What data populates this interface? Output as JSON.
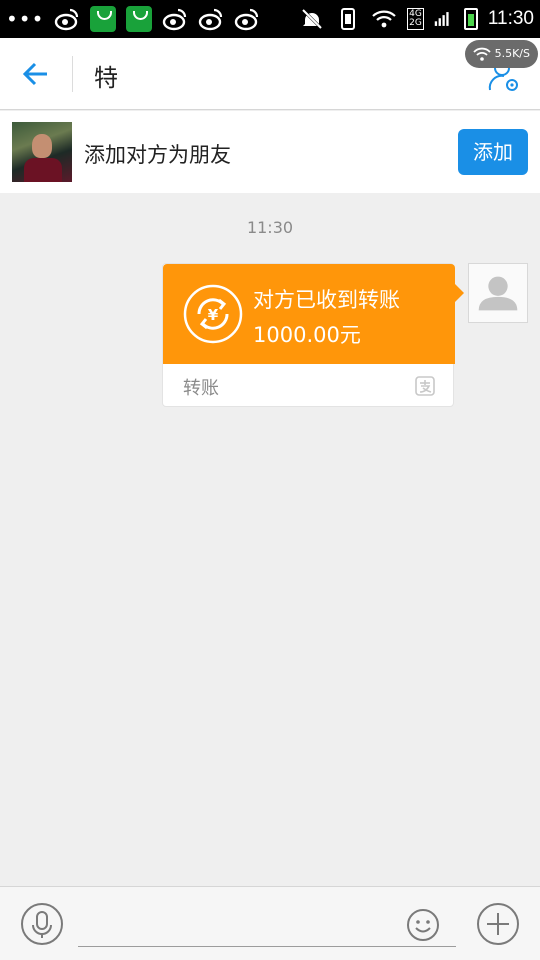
{
  "status_bar": {
    "dots": "•••",
    "network_label": "4G\n2G",
    "time": "11:30"
  },
  "header": {
    "title": "特",
    "speed": "5.5K/S"
  },
  "friend_bar": {
    "text": "添加对方为朋友",
    "add_label": "添加"
  },
  "chat": {
    "timestamp": "11:30",
    "transfer": {
      "title": "对方已收到转账",
      "amount": "1000.00元",
      "label": "转账",
      "accent_color": "#ff960a"
    }
  },
  "input_bar": {
    "placeholder": ""
  },
  "colors": {
    "primary": "#1a8fe6",
    "transfer": "#ff960a",
    "background": "#efefef"
  },
  "icons": [
    "back-arrow-icon",
    "profile-settings-icon",
    "yuan-transfer-icon",
    "alipay-icon",
    "microphone-icon",
    "emoji-icon",
    "plus-icon"
  ]
}
